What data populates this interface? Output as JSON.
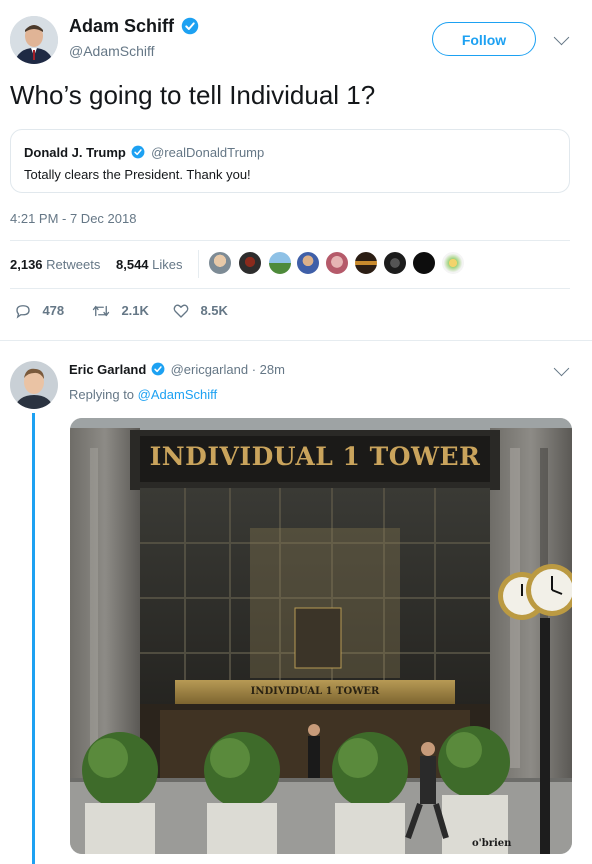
{
  "main_tweet": {
    "author_name": "Adam Schiff",
    "author_handle": "@AdamSchiff",
    "follow_label": "Follow",
    "text": "Who’s going to tell Individual 1?",
    "timestamp": "4:21 PM - 7 Dec 2018",
    "quoted": {
      "author_name": "Donald J. Trump",
      "author_handle": "@realDonaldTrump",
      "text": "Totally clears the President. Thank you!"
    },
    "stats": {
      "retweets_count": "2,136",
      "retweets_label": "Retweets",
      "likes_count": "8,544",
      "likes_label": "Likes"
    },
    "actions": {
      "reply_count": "478",
      "retweet_count": "2.1K",
      "like_count": "8.5K"
    }
  },
  "reply": {
    "author_name": "Eric Garland",
    "author_handle": "@ericgarland",
    "separator": "·",
    "time": "28m",
    "replying_prefix": "Replying to",
    "replying_to": "@AdamSchiff",
    "image": {
      "sign_text": "INDIVIDUAL 1 TOWER",
      "lower_sign_text": "INDIVIDUAL 1 TOWER",
      "credit": "o'brien"
    }
  },
  "colors": {
    "accent": "#1da1f2",
    "muted": "#657786",
    "text": "#14171a",
    "border": "#e1e8ed"
  }
}
